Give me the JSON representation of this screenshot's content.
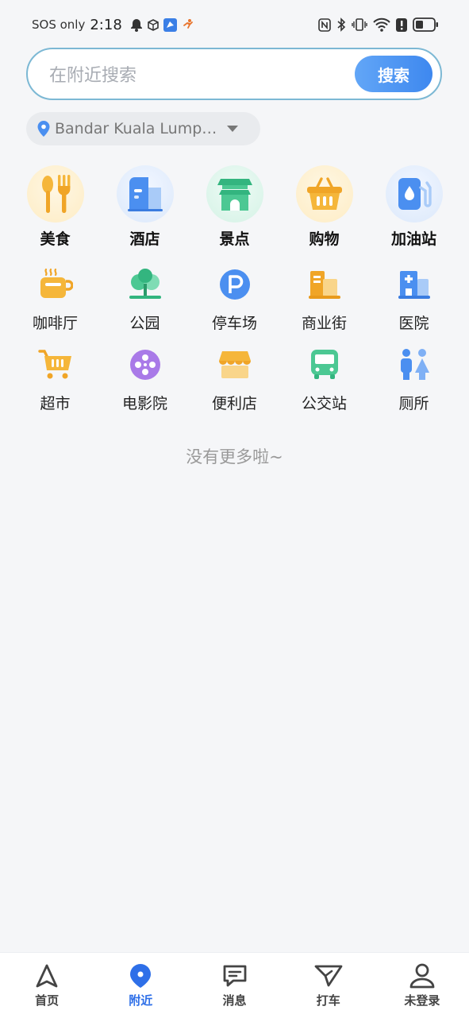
{
  "status_bar": {
    "carrier": "SOS only",
    "time": "2:18"
  },
  "search": {
    "placeholder": "在附近搜索",
    "button": "搜索"
  },
  "location": {
    "text": "Bandar Kuala Lumpur..."
  },
  "categories_featured": [
    {
      "label": "美食",
      "icon": "food-icon",
      "bg": "#fdf2d8"
    },
    {
      "label": "酒店",
      "icon": "hotel-icon",
      "bg": "#e3eefc"
    },
    {
      "label": "景点",
      "icon": "attraction-icon",
      "bg": "#e2f6ee"
    },
    {
      "label": "购物",
      "icon": "shopping-icon",
      "bg": "#fdf2d8"
    },
    {
      "label": "加油站",
      "icon": "gas-station-icon",
      "bg": "#e3eefc"
    }
  ],
  "categories_row2": [
    {
      "label": "咖啡厅",
      "icon": "cafe-icon"
    },
    {
      "label": "公园",
      "icon": "park-icon"
    },
    {
      "label": "停车场",
      "icon": "parking-icon"
    },
    {
      "label": "商业街",
      "icon": "commercial-street-icon"
    },
    {
      "label": "医院",
      "icon": "hospital-icon"
    }
  ],
  "categories_row3": [
    {
      "label": "超市",
      "icon": "supermarket-icon"
    },
    {
      "label": "电影院",
      "icon": "cinema-icon"
    },
    {
      "label": "便利店",
      "icon": "convenience-store-icon"
    },
    {
      "label": "公交站",
      "icon": "bus-stop-icon"
    },
    {
      "label": "厕所",
      "icon": "restroom-icon"
    }
  ],
  "footer_text": "没有更多啦~",
  "bottom_nav": [
    {
      "label": "首页",
      "icon": "home-arrow-icon",
      "active": false
    },
    {
      "label": "附近",
      "icon": "nearby-pin-icon",
      "active": true
    },
    {
      "label": "消息",
      "icon": "message-icon",
      "active": false
    },
    {
      "label": "打车",
      "icon": "taxi-icon",
      "active": false
    },
    {
      "label": "未登录",
      "icon": "user-icon",
      "active": false
    }
  ],
  "colors": {
    "accent": "#3e88ef",
    "active_nav": "#2e6fe8",
    "search_border": "#7cb8d4",
    "background": "#f5f6f8"
  }
}
